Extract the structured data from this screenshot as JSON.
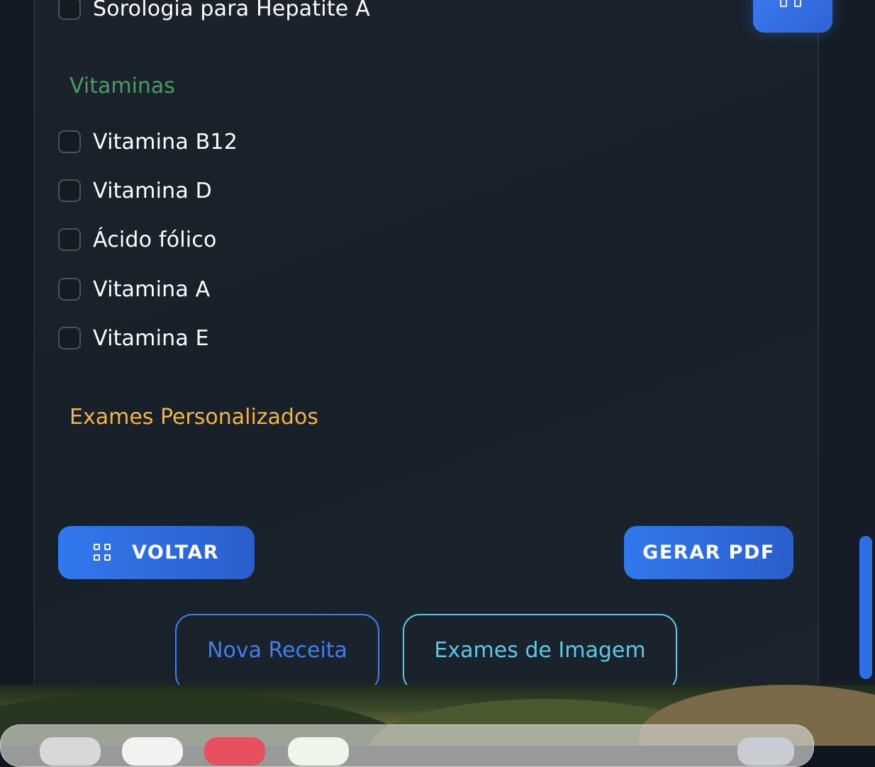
{
  "previous_exam": {
    "label": "Sorologia para Hepatite A",
    "checked": false
  },
  "sections": {
    "vitaminas": {
      "title": "Vitaminas",
      "title_color": "#4a9a62",
      "items": [
        {
          "label": "Vitamina B12",
          "checked": false
        },
        {
          "label": "Vitamina D",
          "checked": false
        },
        {
          "label": "Ácido fólico",
          "checked": false
        },
        {
          "label": "Vitamina A",
          "checked": false
        },
        {
          "label": "Vitamina E",
          "checked": false
        }
      ]
    },
    "personalizados": {
      "title": "Exames Personalizados",
      "title_color": "#f2b544"
    }
  },
  "actions": {
    "back_label": "VOLTAR",
    "pdf_label": "GERAR PDF",
    "new_prescription_label": "Nova Receita",
    "imaging_label": "Exames de Imagem"
  },
  "colors": {
    "accent": "#3278ee",
    "new_prescription": "#3f7ff0",
    "imaging": "#5cc7e6",
    "background": "#161d26"
  },
  "icons": {
    "back": "grid-icon",
    "fab": "grid-icon"
  }
}
